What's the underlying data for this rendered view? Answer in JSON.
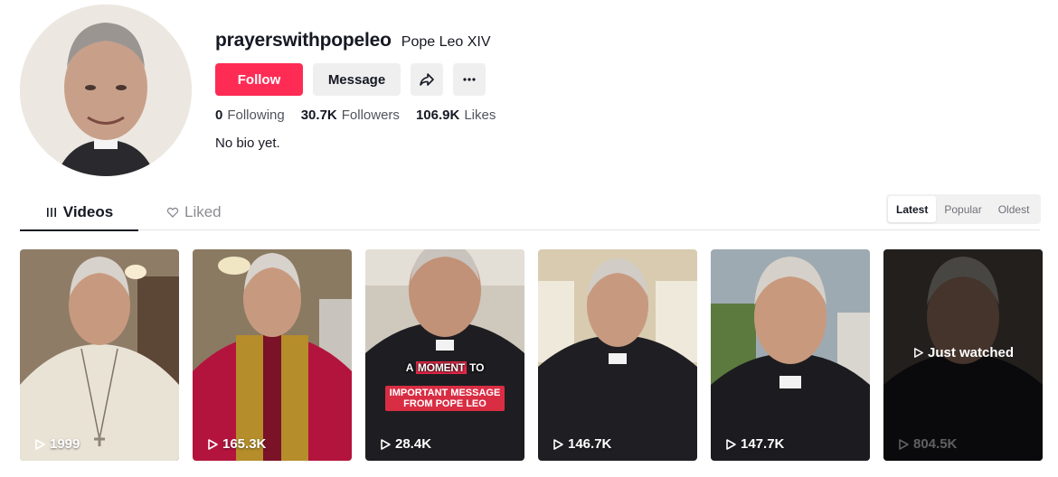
{
  "profile": {
    "username": "prayerswithpopeleo",
    "nickname": "Pope Leo XIV",
    "bio": "No bio yet.",
    "buttons": {
      "follow": "Follow",
      "message": "Message"
    },
    "stats": [
      {
        "value": "0",
        "label": "Following"
      },
      {
        "value": "30.7K",
        "label": "Followers"
      },
      {
        "value": "106.9K",
        "label": "Likes"
      }
    ]
  },
  "tabs": [
    {
      "label": "Videos",
      "icon": "grid-icon",
      "active": true
    },
    {
      "label": "Liked",
      "icon": "heart-lock-icon",
      "active": false
    }
  ],
  "sort": [
    "Latest",
    "Popular",
    "Oldest"
  ],
  "videos": [
    {
      "views": "1999"
    },
    {
      "views": "165.3K"
    },
    {
      "views": "28.4K",
      "caption_line1_pre": "A ",
      "caption_line1_hl": "MOMENT",
      "caption_line1_post": " TO",
      "caption_line2": "IMPORTANT MESSAGE FROM POPE LEO"
    },
    {
      "views": "146.7K"
    },
    {
      "views": "147.7K"
    },
    {
      "views": "804.5K",
      "overlay": "Just watched"
    }
  ],
  "colors": {
    "accent": "#fe2c55",
    "text": "#161823",
    "button_bg": "#efeff0"
  }
}
